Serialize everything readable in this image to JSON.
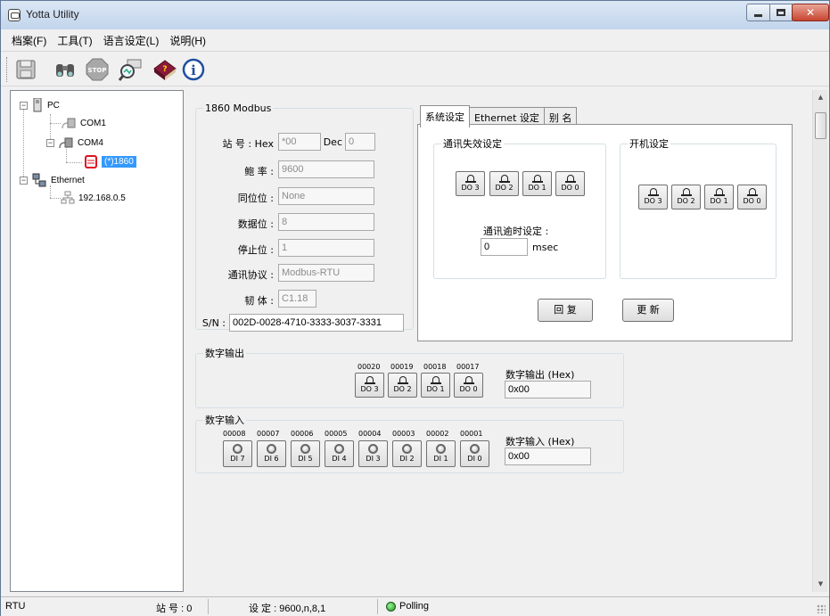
{
  "window": {
    "title": "Yotta Utility"
  },
  "menu": [
    "档案(F)",
    "工具(T)",
    "语言设定(L)",
    "说明(H)"
  ],
  "toolbar": [
    "save-icon",
    "find-icon",
    "stop-icon",
    "search-device-icon",
    "help-book-icon",
    "info-icon"
  ],
  "tree": {
    "root": "PC",
    "com1": "COM1",
    "com4": "COM4",
    "device": "(*)1860",
    "ethernet": "Ethernet",
    "ip": "192.168.0.5"
  },
  "module": {
    "title": "1860 Modbus",
    "station_label": "站 号 : Hex",
    "hex_value": "*00",
    "dec_label": "Dec",
    "dec_value": "0",
    "baud_label": "鲍 率 :",
    "baud_value": "9600",
    "parity_label": "同位位 :",
    "parity_value": "None",
    "databits_label": "数据位 :",
    "databits_value": "8",
    "stopbits_label": "停止位 :",
    "stopbits_value": "1",
    "protocol_label": "通讯协议 :",
    "protocol_value": "Modbus-RTU",
    "firmware_label": "韧 体 :",
    "firmware_value": "C1.18",
    "sn_label": "S/N :",
    "sn_value": "002D-0028-4710-3333-3037-3331"
  },
  "tabs": [
    "系统设定",
    "Ethernet 设定",
    "别 名"
  ],
  "system": {
    "comm_fail_title": "通讯失效设定",
    "power_on_title": "开机设定",
    "do_labels": [
      "DO 3",
      "DO 2",
      "DO 1",
      "DO 0"
    ],
    "timeout_label": "通讯逾时设定 :",
    "timeout_value": "0",
    "timeout_unit": "msec",
    "restore_label": "回 复",
    "update_label": "更 新"
  },
  "digital_output": {
    "title": "数字输出",
    "addresses": [
      "00020",
      "00019",
      "00018",
      "00017"
    ],
    "labels": [
      "DO 3",
      "DO 2",
      "DO 1",
      "DO 0"
    ],
    "hex_label": "数字输出 (Hex)",
    "hex_value": "0x00"
  },
  "digital_input": {
    "title": "数字输入",
    "addresses": [
      "00008",
      "00007",
      "00006",
      "00005",
      "00004",
      "00003",
      "00002",
      "00001"
    ],
    "labels": [
      "DI 7",
      "DI 6",
      "DI 5",
      "DI 4",
      "DI 3",
      "DI 2",
      "DI 1",
      "DI 0"
    ],
    "hex_label": "数字输入 (Hex)",
    "hex_value": "0x00"
  },
  "status": {
    "mode": "RTU",
    "station": "站 号 : 0",
    "settings": "设 定 : 9600,n,8,1",
    "polling": "Polling"
  },
  "colors": {
    "selection": "#3399ff",
    "polling_led": "#1a8f1a",
    "close_button": "#c7452f"
  }
}
